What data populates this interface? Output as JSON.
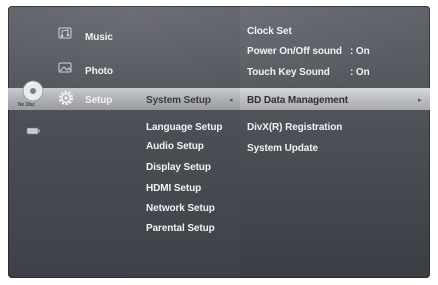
{
  "main_menu": {
    "music": "Music",
    "photo": "Photo",
    "setup": "Setup"
  },
  "disc_label": "No Disc",
  "submenu": {
    "system_setup": "System Setup",
    "items": [
      "Language Setup",
      "Audio Setup",
      "Display Setup",
      "HDMI Setup",
      "Network Setup",
      "Parental Setup"
    ]
  },
  "system_panel": {
    "clock_set": "Clock Set",
    "power_sound": {
      "label": "Power On/Off sound",
      "value": ": On"
    },
    "touch_key": {
      "label": "Touch Key Sound",
      "value": ": On"
    },
    "bd_data": "BD Data Management",
    "divx": "DivX(R) Registration",
    "system_update": "System Update"
  },
  "arrows": {
    "left": "◂",
    "right": "▸"
  }
}
